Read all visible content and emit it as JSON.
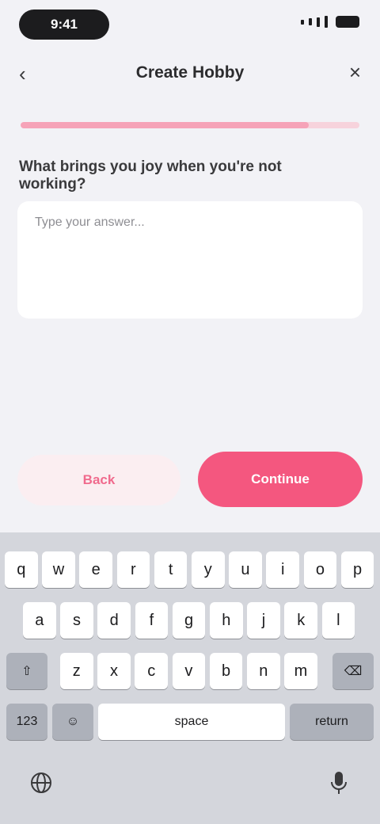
{
  "status": {
    "time": "9:41"
  },
  "nav": {
    "title": "Create Hobby",
    "back_icon": "chevron-left-icon",
    "more_icon": "close-icon"
  },
  "progress": {
    "fraction": 0.85
  },
  "question": {
    "text": "What brings you joy when you're not working?"
  },
  "answer": {
    "placeholder": "Type your answer..."
  },
  "buttons": {
    "secondary_label": "Back",
    "primary_label": "Continue"
  },
  "colors": {
    "accent": "#f4577f",
    "accent_light": "#fbeef1",
    "progress_track": "#f7d3dc"
  },
  "keyboard": {
    "row1": [
      "q",
      "w",
      "e",
      "r",
      "t",
      "y",
      "u",
      "i",
      "o",
      "p"
    ],
    "row2": [
      "a",
      "s",
      "d",
      "f",
      "g",
      "h",
      "j",
      "k",
      "l"
    ],
    "row3": [
      "z",
      "x",
      "c",
      "v",
      "b",
      "n",
      "m"
    ],
    "shift_label": "⇧",
    "delete_label": "⌫",
    "numbers_label": "123",
    "emoji_label": "☺",
    "space_label": "space",
    "return_label": "return"
  }
}
